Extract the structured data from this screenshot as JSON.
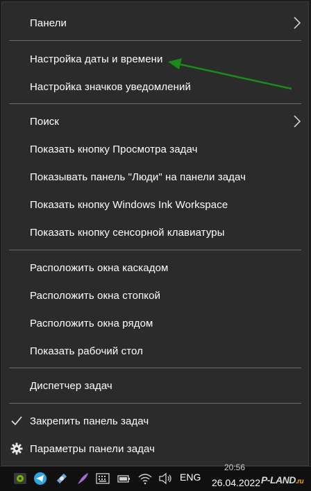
{
  "menu": {
    "panels_label": "Панели",
    "date_time_settings_label": "Настройка даты и времени",
    "notification_icons_label": "Настройка значков уведомлений",
    "search_label": "Поиск",
    "show_task_view_label": "Показать кнопку Просмотра задач",
    "show_people_label": "Показывать панель \"Люди\" на панели задач",
    "show_ink_workspace_label": "Показать кнопку Windows Ink Workspace",
    "show_touch_keyboard_label": "Показать кнопку сенсорной клавиатуры",
    "cascade_windows_label": "Расположить окна каскадом",
    "stack_windows_label": "Расположить окна стопкой",
    "side_by_side_label": "Расположить окна рядом",
    "show_desktop_label": "Показать рабочий стол",
    "task_manager_label": "Диспетчер задач",
    "lock_taskbar_label": "Закрепить панель задач",
    "taskbar_settings_label": "Параметры панели задач",
    "lock_taskbar_checked": true
  },
  "annotation": {
    "arrow_color": "#1a8a1a"
  },
  "taskbar": {
    "language": "ENG",
    "time": "20:56",
    "date": "26.04.2022",
    "watermark": "P-LAND",
    "watermark_suffix": ".ru",
    "tray_icons": [
      "nvidia-icon",
      "telegram-icon",
      "satellite-icon",
      "feather-icon",
      "keyboard-icon",
      "battery-icon",
      "wifi-icon",
      "volume-icon"
    ]
  },
  "colors": {
    "menu_bg": "#2b2b2b",
    "separator": "#6a6a6a",
    "text": "#ffffff",
    "taskbar_bg": "#101010"
  }
}
